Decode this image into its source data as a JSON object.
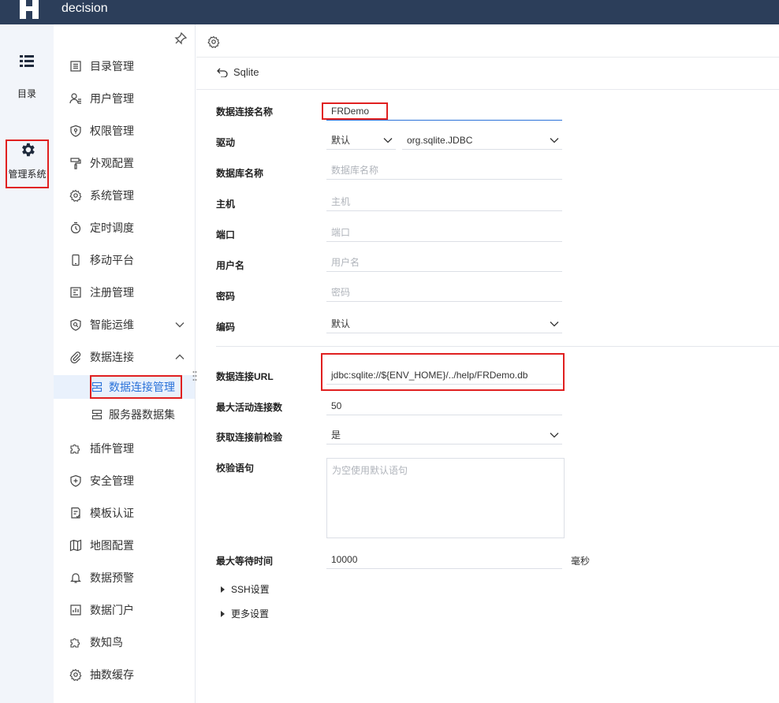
{
  "app": {
    "title": "decision"
  },
  "rail": [
    {
      "label": "目录",
      "icon": "list-icon"
    },
    {
      "label": "管理系统",
      "icon": "gear-icon"
    }
  ],
  "nav": {
    "items": [
      {
        "label": "目录管理",
        "icon": "catalog-icon"
      },
      {
        "label": "用户管理",
        "icon": "user-icon"
      },
      {
        "label": "权限管理",
        "icon": "shield-key-icon"
      },
      {
        "label": "外观配置",
        "icon": "paint-roller-icon"
      },
      {
        "label": "系统管理",
        "icon": "gear-icon"
      },
      {
        "label": "定时调度",
        "icon": "timer-icon"
      },
      {
        "label": "移动平台",
        "icon": "mobile-icon"
      },
      {
        "label": "注册管理",
        "icon": "register-icon"
      },
      {
        "label": "智能运维",
        "icon": "ops-icon"
      },
      {
        "label": "数据连接",
        "icon": "paperclip-icon"
      },
      {
        "label": "插件管理",
        "icon": "puzzle-icon"
      },
      {
        "label": "安全管理",
        "icon": "shield-plus-icon"
      },
      {
        "label": "模板认证",
        "icon": "template-cert-icon"
      },
      {
        "label": "地图配置",
        "icon": "map-icon"
      },
      {
        "label": "数据预警",
        "icon": "bell-icon"
      },
      {
        "label": "数据门户",
        "icon": "portal-icon"
      },
      {
        "label": "数知鸟",
        "icon": "puzzle-icon"
      },
      {
        "label": "抽数缓存",
        "icon": "gear-icon"
      }
    ],
    "sub": [
      {
        "label": "数据连接管理",
        "icon": "db-connection-icon"
      },
      {
        "label": "服务器数据集",
        "icon": "server-dataset-icon"
      }
    ]
  },
  "main": {
    "back_label": "Sqlite",
    "form": {
      "name_label": "数据连接名称",
      "name_value": "FRDemo",
      "driver_label": "驱动",
      "driver_mode": "默认",
      "driver_class": "org.sqlite.JDBC",
      "dbname_label": "数据库名称",
      "dbname_placeholder": "数据库名称",
      "host_label": "主机",
      "host_placeholder": "主机",
      "port_label": "端口",
      "port_placeholder": "端口",
      "user_label": "用户名",
      "user_placeholder": "用户名",
      "password_label": "密码",
      "password_placeholder": "密码",
      "encoding_label": "编码",
      "encoding_value": "默认",
      "url_label": "数据连接URL",
      "url_value": "jdbc:sqlite://${ENV_HOME}/../help/FRDemo.db",
      "max_active_label": "最大活动连接数",
      "max_active_value": "50",
      "test_before_label": "获取连接前检验",
      "test_before_value": "是",
      "validation_label": "校验语句",
      "validation_placeholder": "为空使用默认语句",
      "max_wait_label": "最大等待时间",
      "max_wait_value": "10000",
      "max_wait_unit": "毫秒",
      "ssh_label": "SSH设置",
      "more_label": "更多设置"
    }
  },
  "colors": {
    "topbar": "#2c3e5a",
    "accent": "#2a72d9",
    "highlight": "#e02020"
  }
}
